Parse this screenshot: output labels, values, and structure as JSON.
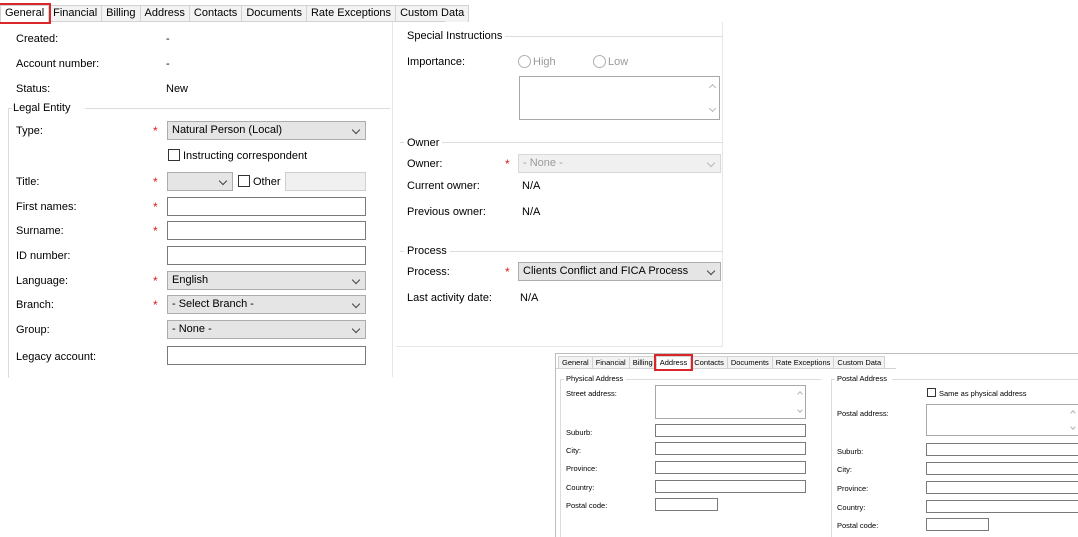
{
  "tabs": [
    "General",
    "Financial",
    "Billing",
    "Address",
    "Contacts",
    "Documents",
    "Rate Exceptions",
    "Custom Data"
  ],
  "active_tab": "General",
  "general": {
    "created_label": "Created:",
    "created_value": "-",
    "account_label": "Account number:",
    "account_value": "-",
    "status_label": "Status:",
    "status_value": "New",
    "legal_entity_title": "Legal Entity",
    "type_label": "Type:",
    "type_value": "Natural Person (Local)",
    "instructing_label": "Instructing correspondent",
    "title_label": "Title:",
    "other_label": "Other",
    "first_names_label": "First names:",
    "surname_label": "Surname:",
    "id_label": "ID number:",
    "language_label": "Language:",
    "language_value": "English",
    "branch_label": "Branch:",
    "branch_value": "- Select Branch -",
    "group_label": "Group:",
    "group_value": "- None -",
    "legacy_label": "Legacy account:",
    "required_mark": "*"
  },
  "special": {
    "title": "Special Instructions",
    "importance_label": "Importance:",
    "high_label": "High",
    "low_label": "Low"
  },
  "owner": {
    "title": "Owner",
    "owner_label": "Owner:",
    "owner_value": "- None -",
    "current_label": "Current owner:",
    "current_value": "N/A",
    "previous_label": "Previous owner:",
    "previous_value": "N/A"
  },
  "process": {
    "title": "Process",
    "process_label": "Process:",
    "process_value": "Clients Conflict and FICA Process",
    "last_label": "Last activity date:",
    "last_value": "N/A"
  },
  "address_inset": {
    "tabs": [
      "General",
      "Financial",
      "Billing",
      "Address",
      "Contacts",
      "Documents",
      "Rate Exceptions",
      "Custom Data"
    ],
    "active_tab": "Address",
    "physical_title": "Physical Address",
    "street_label": "Street address:",
    "suburb_label": "Suburb:",
    "city_label": "City:",
    "province_label": "Province:",
    "country_label": "Country:",
    "postal_code_label": "Postal code:",
    "postal_title": "Postal Address",
    "same_as_label": "Same as physical address",
    "postal_address_label": "Postal address:",
    "p_suburb_label": "Suburb:",
    "p_city_label": "City:",
    "p_province_label": "Province:",
    "p_country_label": "Country:",
    "p_postal_code_label": "Postal code:"
  },
  "colors": {
    "highlight": "#d9262b",
    "required": "#e21b1b"
  },
  "icons": [
    "chevron-down-icon",
    "scroll-up-icon",
    "scroll-down-icon"
  ]
}
